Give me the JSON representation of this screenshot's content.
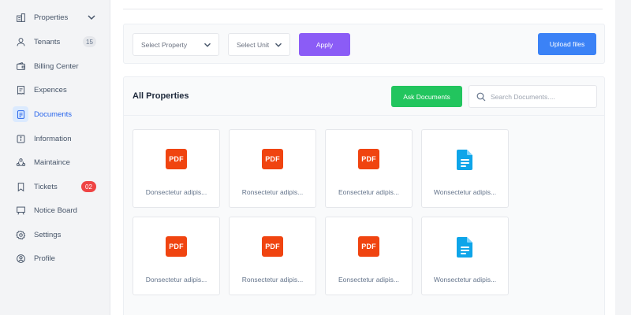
{
  "sidebar": {
    "items": [
      {
        "label": "Properties",
        "icon": "building-icon"
      },
      {
        "label": "Tenants",
        "icon": "user-icon",
        "badge": "15"
      },
      {
        "label": "Billing Center",
        "icon": "wallet-icon"
      },
      {
        "label": "Expences",
        "icon": "receipt-icon"
      },
      {
        "label": "Documents",
        "icon": "document-icon",
        "active": true
      },
      {
        "label": "Information",
        "icon": "info-icon"
      },
      {
        "label": "Maintaince",
        "icon": "team-icon"
      },
      {
        "label": "Tickets",
        "icon": "bookmark-icon",
        "badge": "02"
      },
      {
        "label": "Notice Board",
        "icon": "board-icon"
      },
      {
        "label": "Settings",
        "icon": "gear-icon"
      },
      {
        "label": "Profile",
        "icon": "profile-icon"
      }
    ]
  },
  "filters": {
    "property_placeholder": "Select Property",
    "unit_placeholder": "Select Unit",
    "apply_label": "Apply",
    "upload_label": "Upload files"
  },
  "documents": {
    "title": "All Properties",
    "ask_label": "Ask Documents",
    "search_placeholder": "Search Documents....",
    "files": [
      {
        "name": "Donsectetur adipis...",
        "type": "pdf",
        "badge": "PDF"
      },
      {
        "name": "Ronsectetur adipis...",
        "type": "pdf",
        "badge": "PDF"
      },
      {
        "name": "Eonsectetur adipis...",
        "type": "pdf",
        "badge": "PDF"
      },
      {
        "name": "Wonsectetur adipis...",
        "type": "doc"
      },
      {
        "name": "Donsectetur adipis...",
        "type": "pdf",
        "badge": "PDF"
      },
      {
        "name": "Ronsectetur adipis...",
        "type": "pdf",
        "badge": "PDF"
      },
      {
        "name": "Eonsectetur adipis...",
        "type": "pdf",
        "badge": "PDF"
      },
      {
        "name": "Wonsectetur adipis...",
        "type": "doc"
      }
    ]
  },
  "colors": {
    "accent_active": "#2563eb",
    "apply": "#8b5cf6",
    "upload": "#3b82f6",
    "ask": "#22c55e",
    "pdf": "#f04410",
    "doc": "#0ea5e9",
    "alert_badge": "#ef4444"
  }
}
